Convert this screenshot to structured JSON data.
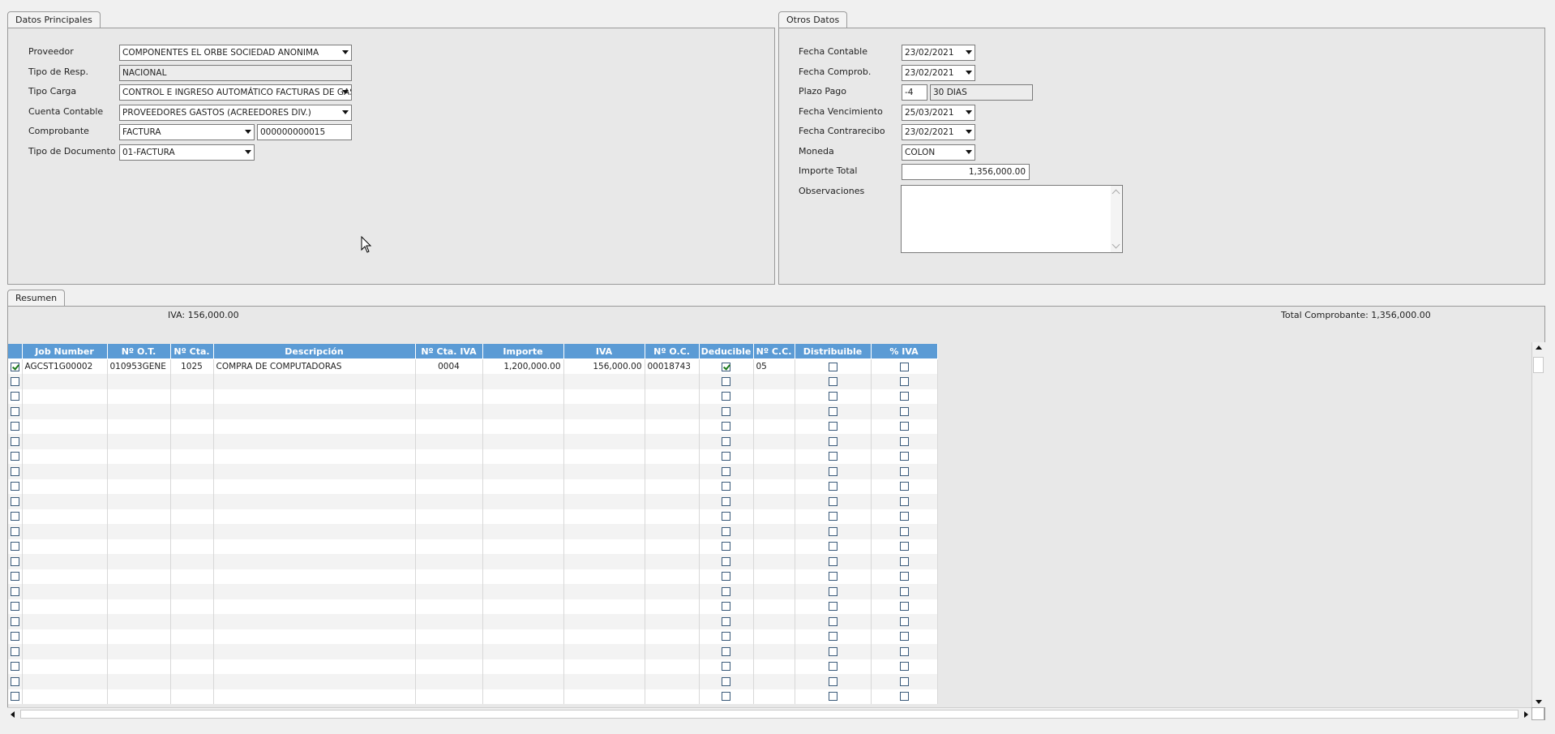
{
  "tabs": {
    "datos_principales": "Datos Principales",
    "otros_datos": "Otros Datos",
    "resumen": "Resumen"
  },
  "datos_principales": {
    "proveedor": {
      "label": "Proveedor",
      "value": "COMPONENTES EL ORBE SOCIEDAD ANONIMA"
    },
    "tipo_resp": {
      "label": "Tipo de Resp.",
      "value": "NACIONAL"
    },
    "tipo_carga": {
      "label": "Tipo Carga",
      "value": "CONTROL E INGRESO AUTOMÁTICO FACTURAS DE GAS"
    },
    "cuenta_contable": {
      "label": "Cuenta Contable",
      "value": "PROVEEDORES GASTOS (ACREEDORES DIV.)"
    },
    "comprobante": {
      "label": "Comprobante",
      "tipo": "FACTURA",
      "numero": "000000000015"
    },
    "tipo_documento": {
      "label": "Tipo de Documento",
      "value": "01-FACTURA"
    }
  },
  "otros_datos": {
    "fecha_contable": {
      "label": "Fecha Contable",
      "value": "23/02/2021"
    },
    "fecha_comprob": {
      "label": "Fecha Comprob.",
      "value": "23/02/2021"
    },
    "plazo_pago": {
      "label": "Plazo Pago",
      "dias": "-4",
      "descripcion": "30 DIAS"
    },
    "fecha_vencimiento": {
      "label": "Fecha Vencimiento",
      "value": "25/03/2021"
    },
    "fecha_contrarecibo": {
      "label": "Fecha Contrarecibo",
      "value": "23/02/2021"
    },
    "moneda": {
      "label": "Moneda",
      "value": "COLON"
    },
    "importe_total": {
      "label": "Importe Total",
      "value": "1,356,000.00"
    },
    "observaciones": {
      "label": "Observaciones",
      "value": ""
    }
  },
  "resumen": {
    "iva": "IVA: 156,000.00",
    "total": "Total Comprobante: 1,356,000.00"
  },
  "grid": {
    "columns": [
      "",
      "Job Number",
      "Nº O.T.",
      "Nº Cta.",
      "Descripción",
      "Nº Cta. IVA",
      "Importe",
      "IVA",
      "Nº O.C.",
      "Deducible",
      "Nº C.C.",
      "Distribuible",
      "% IVA"
    ],
    "rows": [
      {
        "sel": true,
        "job": "AGCST1G00002",
        "ot": "010953GENE",
        "cta": "1025",
        "desc": "COMPRA DE COMPUTADORAS",
        "cta_iva": "0004",
        "importe": "1,200,000.00",
        "iva": "156,000.00",
        "oc": "00018743",
        "deducible": true,
        "cc": "05",
        "distribuible": false,
        "piva": false
      }
    ],
    "empty_rows": 22
  }
}
